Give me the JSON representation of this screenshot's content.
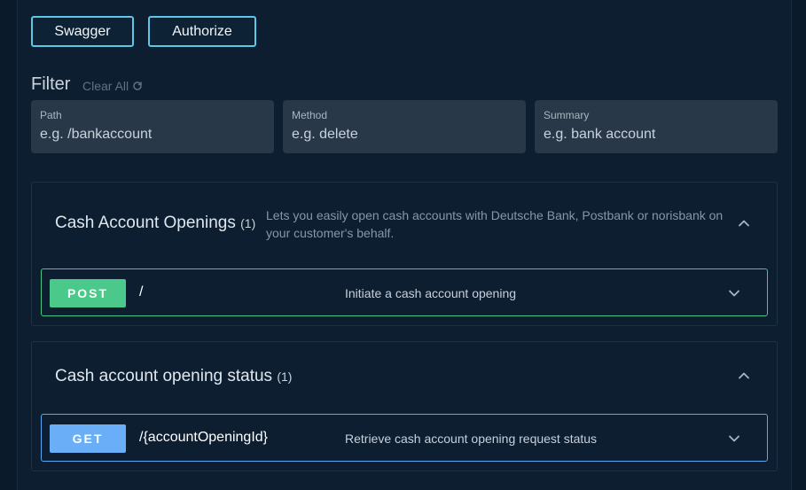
{
  "toolbar": {
    "swagger_label": "Swagger",
    "authorize_label": "Authorize"
  },
  "filter": {
    "title": "Filter",
    "clear_all": "Clear All",
    "fields": [
      {
        "label": "Path",
        "placeholder": "e.g. /bankaccount"
      },
      {
        "label": "Method",
        "placeholder": "e.g. delete"
      },
      {
        "label": "Summary",
        "placeholder": "e.g. bank account"
      }
    ]
  },
  "groups": [
    {
      "title": "Cash Account Openings",
      "count": "(1)",
      "description": "Lets you easily open cash accounts with Deutsche Bank, Postbank or norisbank on your customer's behalf.",
      "expanded": true,
      "operations": [
        {
          "method": "POST",
          "path": "/",
          "summary": "Initiate a cash account opening",
          "color": "#4bc98a"
        }
      ]
    },
    {
      "title": "Cash account opening status",
      "count": "(1)",
      "description": "",
      "expanded": true,
      "operations": [
        {
          "method": "GET",
          "path": "/{accountOpeningId}",
          "summary": "Retrieve cash account opening request status",
          "color": "#6aaef7"
        }
      ]
    }
  ],
  "colors": {
    "background": "#0b1a2b",
    "accent": "#5ec6e6",
    "post": "#4bc98a",
    "get": "#6aaef7"
  },
  "icons": {
    "refresh": "refresh-icon",
    "expand": "chevron-up-icon",
    "collapse": "chevron-down-icon"
  }
}
